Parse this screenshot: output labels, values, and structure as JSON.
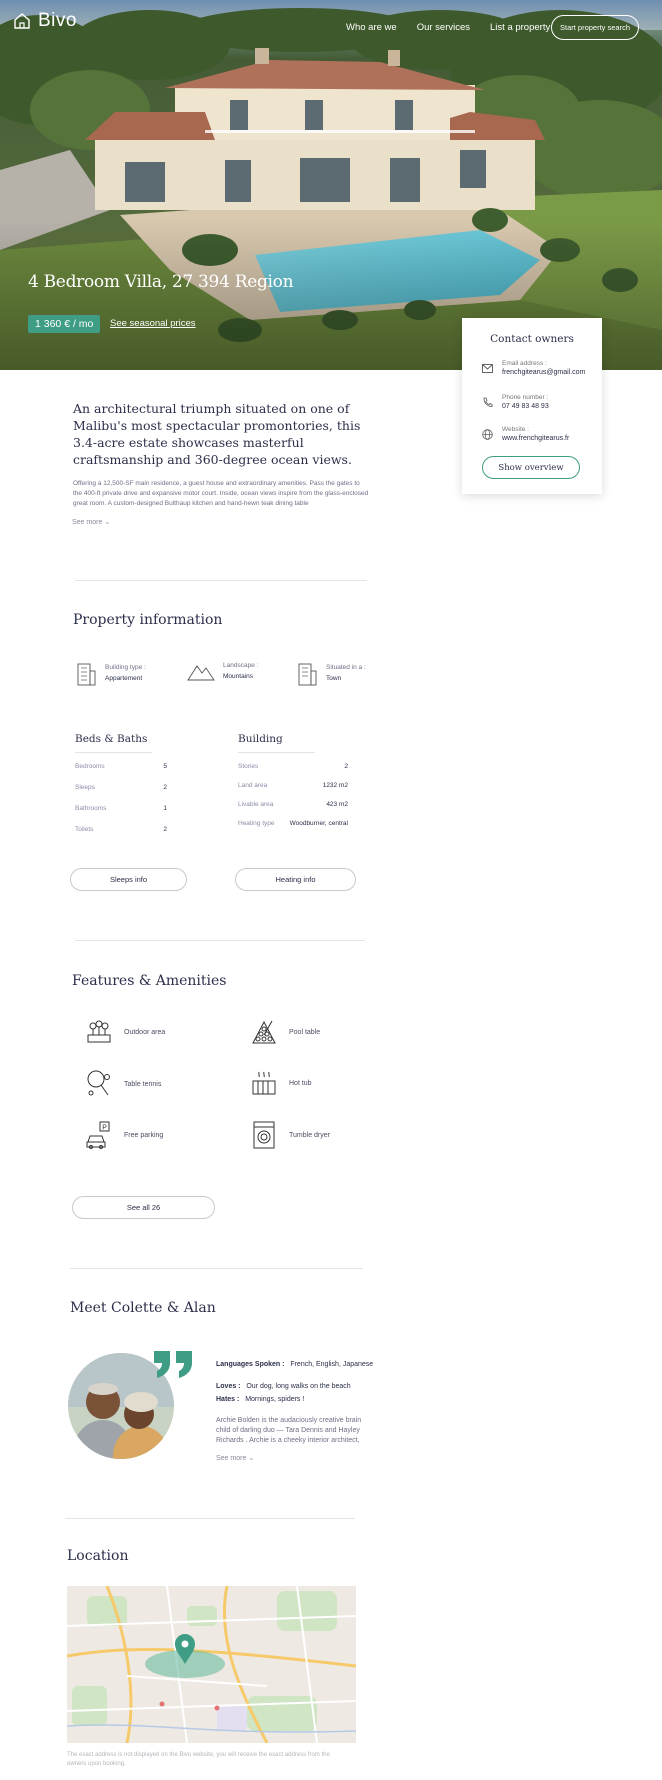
{
  "header": {
    "brand": "Bivo",
    "nav": [
      "Who are we",
      "Our services",
      "List a property"
    ],
    "cta": "Start property search"
  },
  "hero": {
    "title": "4 Bedroom Villa, 27 394 Region",
    "price": "1 360 € / mo",
    "seasonal_link": "See seasonal prices"
  },
  "contact": {
    "title": "Contact owners",
    "email_label": "Email address :",
    "email": "frenchgitearus@gmail.com",
    "phone_label": "Phone number :",
    "phone": "07 49 83 48 93",
    "website_label": "Website :",
    "website": "www.frenchgitearus.fr",
    "button": "Show overview"
  },
  "intro": {
    "lead": "An architectural triumph situated on one of Malibu's most spectacular promontories, this 3.4-acre estate showcases masterful craftsmanship and 360-degree ocean views.",
    "body": "Offering a 12,500-SF main residence, a guest house and extraordinary amenities. Pass the gates to the 400-ft private drive and expansive motor court. Inside, ocean views inspire from the glass-enclosed great room. A custom-designed Bulthaup kitchen and hand-hewn teak dining table",
    "see_more": "See more"
  },
  "property": {
    "title": "Property information",
    "items": [
      {
        "label": "Building type :",
        "value": "Appartement",
        "icon": "building-icon"
      },
      {
        "label": "Landscape :",
        "value": "Mountains",
        "icon": "mountains-icon"
      },
      {
        "label": "Situated in a :",
        "value": "Town",
        "icon": "town-icon"
      }
    ],
    "beds_title": "Beds & Baths",
    "beds": [
      {
        "k": "Bedrooms",
        "v": "5"
      },
      {
        "k": "Sleeps",
        "v": "2"
      },
      {
        "k": "Bathrooms",
        "v": "1"
      },
      {
        "k": "Toilets",
        "v": "2"
      }
    ],
    "building_title": "Building",
    "building": [
      {
        "k": "Stories",
        "v": "2"
      },
      {
        "k": "Land area",
        "v": "1232 m2"
      },
      {
        "k": "Livable area",
        "v": "423 m2"
      },
      {
        "k": "Heating type",
        "v": "Woodburner, central"
      }
    ],
    "sleeps_btn": "Sleeps info",
    "heating_btn": "Heating info"
  },
  "features": {
    "title": "Features & Amenities",
    "items": [
      {
        "label": "Outdoor area",
        "icon": "outdoor-area-icon"
      },
      {
        "label": "Pool table",
        "icon": "pool-table-icon"
      },
      {
        "label": "Table tennis",
        "icon": "table-tennis-icon"
      },
      {
        "label": "Hot tub",
        "icon": "hot-tub-icon"
      },
      {
        "label": "Free parking",
        "icon": "parking-icon"
      },
      {
        "label": "Tumble dryer",
        "icon": "tumble-dryer-icon"
      }
    ],
    "see_all": "See all 26"
  },
  "host": {
    "title": "Meet Colette & Alan",
    "languages_label": "Languages Spoken :",
    "languages": "French, English, Japanese",
    "loves_label": "Loves :",
    "loves": "Our dog, long walks on the beach",
    "hates_label": "Hates :",
    "hates": "Mornings, spiders !",
    "bio": "Archie Bolden is the audaciously creative brain child of darling duo — Tara Dennis and Hayley Richards . Archie is a cheeky interior architect,",
    "see_more": "See more"
  },
  "location": {
    "title": "Location",
    "note": "The exact address is not displayed on the Bivo website, you will receive the exact address from the owners upon booking."
  }
}
